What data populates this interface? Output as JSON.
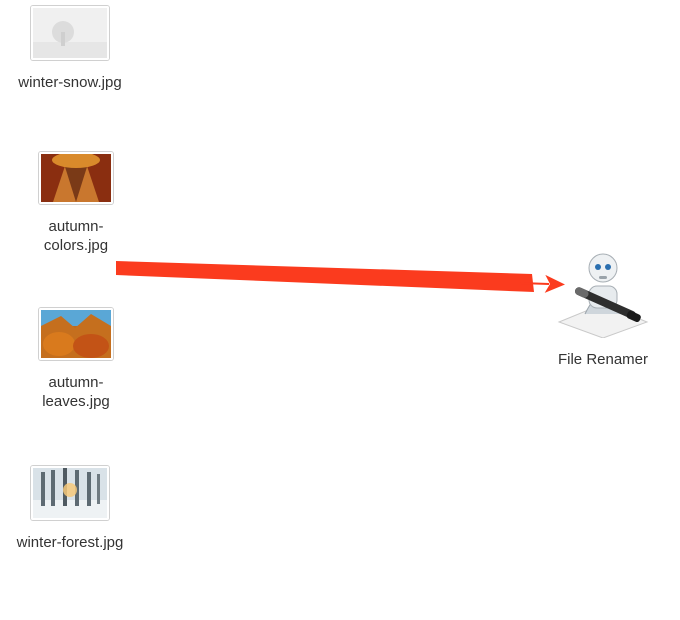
{
  "files": [
    {
      "name": "winter-snow.jpg"
    },
    {
      "name": "autumn-colors.jpg"
    },
    {
      "name": "autumn-leaves.jpg"
    },
    {
      "name": "winter-forest.jpg"
    }
  ],
  "app": {
    "name": "File Renamer"
  },
  "arrow": {
    "color": "#fb3b1e"
  }
}
